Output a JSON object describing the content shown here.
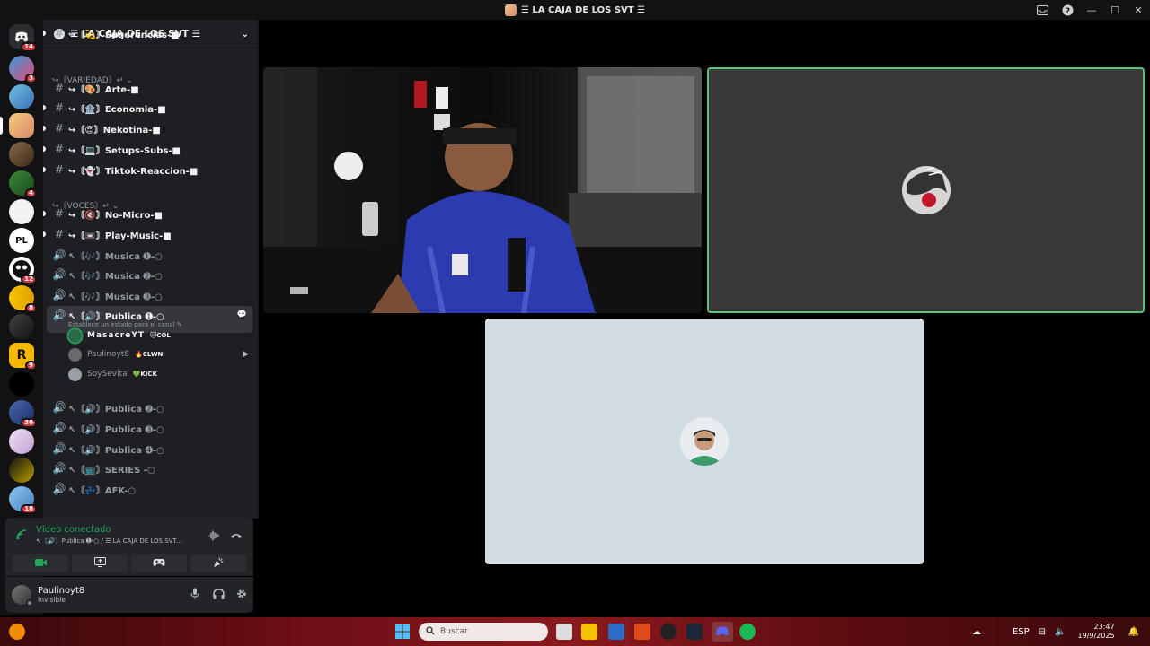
{
  "window": {
    "title": "☰ LA CAJA DE LOS SVT ☰",
    "controls": [
      "—",
      "☐",
      "✕"
    ]
  },
  "server_rail": {
    "badges": [
      "14",
      "3",
      "4",
      "12",
      "8",
      "9",
      "30",
      "18"
    ],
    "letters": {
      "pl": "PL",
      "r": "R"
    }
  },
  "guild": {
    "name": "☰ LA CAJA DE LOS SVT ☰",
    "chevron": "⌄"
  },
  "channels": [
    {
      "type": "text",
      "icon": "#",
      "name": "↪〘💫〙Sugerencias-■"
    },
    {
      "type": "category",
      "name": "↪〘VARIEDAD〙↵ ⌄"
    },
    {
      "type": "text",
      "icon": "#",
      "name": "↪〘🎨〙Arte-■"
    },
    {
      "type": "text",
      "icon": "#",
      "name": "↪〘🏦〙Economia-■"
    },
    {
      "type": "text",
      "icon": "#",
      "name": "↪〘😍〙Nekotina-■"
    },
    {
      "type": "text",
      "icon": "#",
      "name": "↪〘💻〙Setups-Subs-■"
    },
    {
      "type": "text",
      "icon": "#",
      "name": "↪〘👻〙Tiktok-Reaccion-■"
    },
    {
      "type": "category",
      "name": "↪〘VOCES〙↵ ⌄"
    },
    {
      "type": "text",
      "icon": "#",
      "name": "↪〘🔇〙No-Micro-■"
    },
    {
      "type": "text",
      "icon": "#",
      "name": "↪〘📼〙Play-Music-■"
    },
    {
      "type": "voice",
      "icon": "🔊",
      "name": "↖〘🎶〙Musica ➊-○"
    },
    {
      "type": "voice",
      "icon": "🔊",
      "name": "↖〘🎶〙Musica ➋-○"
    },
    {
      "type": "voice",
      "icon": "🔊",
      "name": "↖〘🎶〙Musica ➌-○"
    },
    {
      "type": "voice-active",
      "icon": "🔊",
      "name": "↖〘🔊〙Publica ➊-○",
      "sub": "Establece un estado para el canal ✎"
    },
    {
      "type": "voice",
      "icon": "🔊",
      "name": "↖〘🔊〙Publica ➋-○"
    },
    {
      "type": "voice",
      "icon": "🔊",
      "name": "↖〘🔊〙Publica ➌-○"
    },
    {
      "type": "voice",
      "icon": "🔊",
      "name": "↖〘🔊〙Publica ➍-○"
    },
    {
      "type": "voice",
      "icon": "🔊",
      "name": "↖〘📺〙SERIES -○"
    },
    {
      "type": "voice",
      "icon": "🔊",
      "name": "↖〘💤〙AFK-○"
    }
  ],
  "voice_members": [
    {
      "name": "MasacreYT",
      "tag": "🐱COL",
      "bold": true
    },
    {
      "name": "Paulinoyt8",
      "tag": "🔥CLWN",
      "bold": false
    },
    {
      "name": "SoySevita",
      "tag": "💚KICK",
      "bold": false
    }
  ],
  "voice_panel": {
    "status": "Vídeo conectado",
    "location": "↖〘🔊〙Publica ➊-○ / ☰ LA CAJA DE LOS SVT..."
  },
  "user": {
    "name": "Paulinoyt8",
    "status": "Invisible"
  },
  "taskbar": {
    "search_placeholder": "Buscar",
    "lang": "ESP",
    "time": "23:47",
    "date": "19/9/2025"
  },
  "colors": {
    "connected": "#23a55a",
    "speaking_border": "#5bc27a",
    "badge": "#da373c"
  }
}
